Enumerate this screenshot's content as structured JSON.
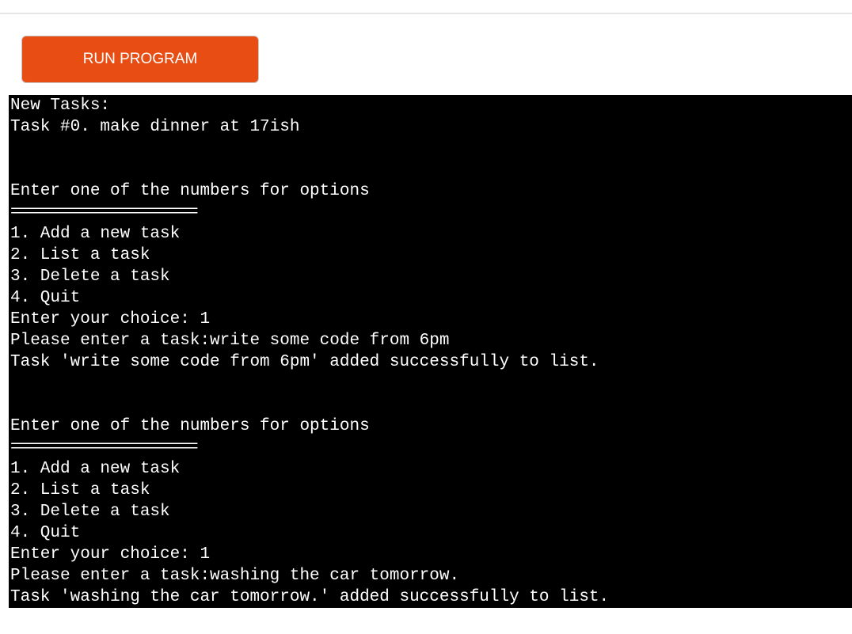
{
  "button": {
    "run_label": "RUN PROGRAM"
  },
  "terminal": {
    "lines": [
      "New Tasks:",
      "Task #0. make dinner at 17ish",
      "",
      "",
      "Enter one of the numbers for options",
      "==========================",
      "1. Add a new task",
      "2. List a task",
      "3. Delete a task",
      "4. Quit",
      "Enter your choice: 1",
      "Please enter a task:write some code from 6pm",
      "Task 'write some code from 6pm' added successfully to list.",
      "",
      "",
      "Enter one of the numbers for options",
      "==========================",
      "1. Add a new task",
      "2. List a task",
      "3. Delete a task",
      "4. Quit",
      "Enter your choice: 1",
      "Please enter a task:washing the car tomorrow.",
      "Task 'washing the car tomorrow.' added successfully to list."
    ]
  }
}
